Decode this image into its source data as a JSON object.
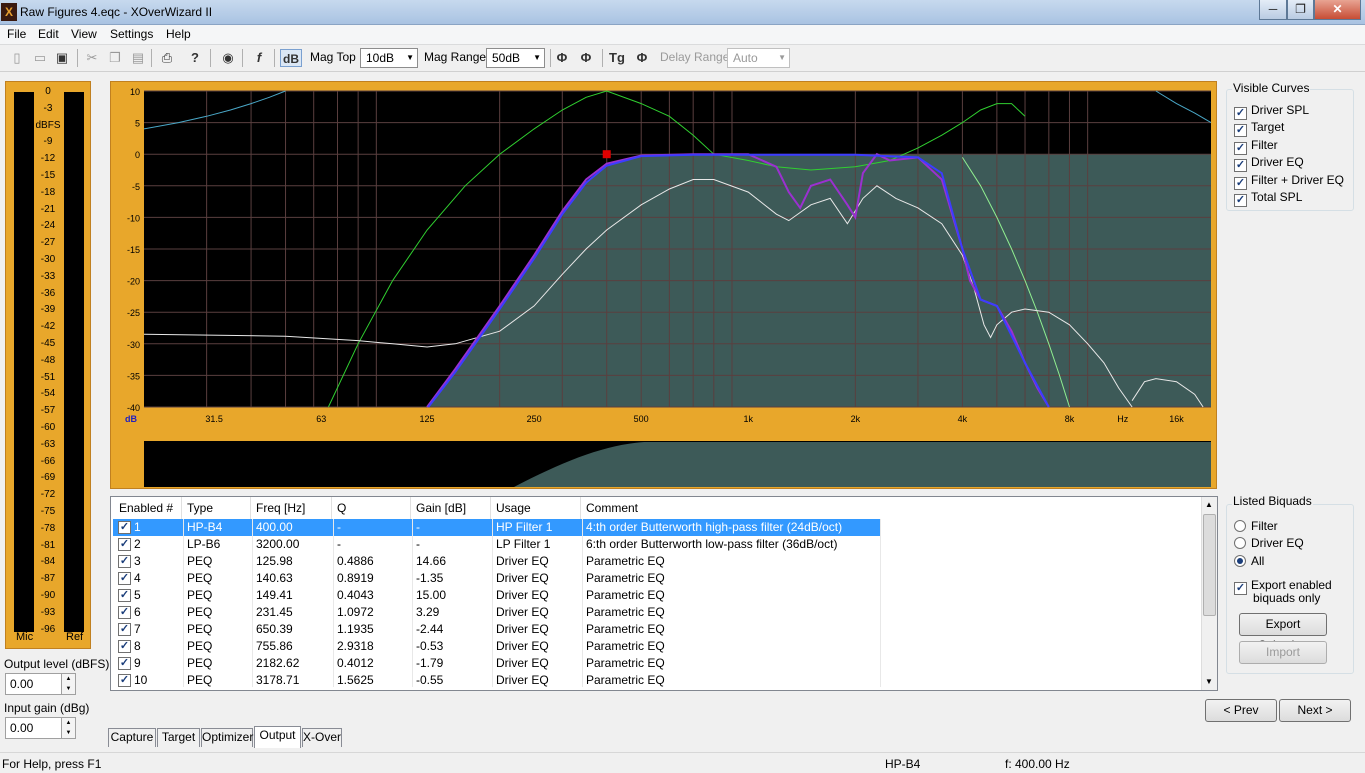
{
  "window": {
    "title": "Raw Figures 4.eqc - XOverWizard II",
    "app_icon": "X",
    "minimize": "─",
    "maximize": "❐",
    "close": "✕"
  },
  "menu": [
    "File",
    "Edit",
    "View",
    "Settings",
    "Help"
  ],
  "toolbar": {
    "db_button": "dB",
    "mag_top_label": "Mag Top",
    "mag_top_value": "10dB",
    "mag_range_label": "Mag Range",
    "mag_range_value": "50dB",
    "delay_range_label": "Delay Range",
    "delay_range_value": "Auto",
    "icons": [
      "new-icon",
      "open-icon",
      "save-icon",
      "cut-icon",
      "copy-icon",
      "paste-icon",
      "print-icon",
      "help-icon",
      "speaker-icon",
      "lock-icon",
      "phase-icon",
      "wrapped-phase-icon",
      "group-delay-icon",
      "delay-phase-icon"
    ]
  },
  "meter": {
    "unit": "dBFS",
    "ticks": [
      "0",
      "-3",
      "dBFS",
      "-9",
      "-12",
      "-15",
      "-18",
      "-21",
      "-24",
      "-27",
      "-30",
      "-33",
      "-36",
      "-39",
      "-42",
      "-45",
      "-48",
      "-51",
      "-54",
      "-57",
      "-60",
      "-63",
      "-66",
      "-69",
      "-72",
      "-75",
      "-78",
      "-81",
      "-84",
      "-87",
      "-90",
      "-93",
      "-96"
    ],
    "left_label": "Mic",
    "right_label": "Ref"
  },
  "output_level": {
    "label": "Output level (dBFS)",
    "value": "0.00"
  },
  "input_gain": {
    "label": "Input gain (dBg)",
    "value": "0.00"
  },
  "chart_data": {
    "type": "line",
    "yunit": "dB",
    "xunit": "Hz",
    "x_scale": "log",
    "xlim": [
      20,
      20000
    ],
    "ylim": [
      -40,
      10
    ],
    "x_ticks": [
      "31.5",
      "63",
      "125",
      "250",
      "500",
      "1k",
      "2k",
      "4k",
      "8k",
      "16k"
    ],
    "x_tick_values": [
      31.5,
      63,
      125,
      250,
      500,
      1000,
      2000,
      4000,
      8000,
      16000
    ],
    "y_ticks": [
      "10",
      "5",
      "0",
      "-5",
      "-10",
      "-15",
      "-20",
      "-25",
      "-30",
      "-35",
      "-40"
    ],
    "y_tick_values": [
      10,
      5,
      0,
      -5,
      -10,
      -15,
      -20,
      -25,
      -30,
      -35,
      -40
    ],
    "grid": true,
    "marker": {
      "x": 400,
      "y": 0
    },
    "colors": {
      "background": "#000000",
      "fill": "#3d5a58",
      "green": "#30d030",
      "light_green": "#90ee90",
      "blue": "#3c3cff",
      "purple": "#9b30d0",
      "white": "#e8e8e8",
      "cyan": "#4aa8c8",
      "marker": "#e00000"
    },
    "series": [
      {
        "color": "#30d030",
        "points": [
          [
            66,
            -40
          ],
          [
            80,
            -30
          ],
          [
            100,
            -20
          ],
          [
            125,
            -12
          ],
          [
            160,
            -5
          ],
          [
            200,
            0
          ],
          [
            250,
            4
          ],
          [
            300,
            7
          ],
          [
            350,
            9
          ],
          [
            400,
            10
          ],
          [
            500,
            8
          ],
          [
            600,
            6
          ],
          [
            700,
            3
          ],
          [
            800,
            0
          ],
          [
            1000,
            -1
          ],
          [
            1200,
            -2
          ],
          [
            1500,
            -2.5
          ],
          [
            2000,
            -2
          ],
          [
            2500,
            -1
          ],
          [
            3000,
            1
          ],
          [
            3500,
            3
          ],
          [
            4000,
            5
          ],
          [
            4500,
            7
          ],
          [
            5000,
            8
          ],
          [
            5500,
            8
          ],
          [
            6000,
            6
          ]
        ]
      },
      {
        "color": "#90ee90",
        "points": [
          [
            4000,
            -0.5
          ],
          [
            4500,
            -5
          ],
          [
            5000,
            -10
          ],
          [
            5500,
            -15
          ],
          [
            6000,
            -20
          ],
          [
            6500,
            -25
          ],
          [
            7000,
            -30
          ],
          [
            7500,
            -35
          ],
          [
            8000,
            -40
          ]
        ]
      },
      {
        "color": "#e8e8e8",
        "points": [
          [
            20,
            -28.5
          ],
          [
            50,
            -28.8
          ],
          [
            80,
            -29.5
          ],
          [
            100,
            -30
          ],
          [
            125,
            -30.5
          ],
          [
            150,
            -30
          ],
          [
            200,
            -28
          ],
          [
            250,
            -24
          ],
          [
            300,
            -19
          ],
          [
            350,
            -15
          ],
          [
            400,
            -12
          ],
          [
            500,
            -8
          ],
          [
            600,
            -5.5
          ],
          [
            700,
            -4
          ],
          [
            800,
            -4
          ],
          [
            1000,
            -6
          ],
          [
            1200,
            -9.5
          ],
          [
            1300,
            -10.5
          ],
          [
            1500,
            -8
          ],
          [
            1700,
            -7
          ],
          [
            1900,
            -11
          ],
          [
            2100,
            -7
          ],
          [
            2300,
            -5
          ],
          [
            2600,
            -7
          ],
          [
            3000,
            -8.5
          ],
          [
            3500,
            -11
          ],
          [
            4000,
            -16
          ],
          [
            4300,
            -21
          ],
          [
            4600,
            -27
          ],
          [
            4800,
            -29
          ],
          [
            5000,
            -27
          ],
          [
            5500,
            -25
          ],
          [
            6000,
            -24.5
          ],
          [
            7000,
            -25
          ],
          [
            8000,
            -27
          ],
          [
            9000,
            -30
          ],
          [
            10000,
            -33
          ],
          [
            11000,
            -37
          ],
          [
            12000,
            -40
          ]
        ]
      },
      {
        "color": "#e8e8e8",
        "points": [
          [
            12000,
            -39
          ],
          [
            13000,
            -36
          ],
          [
            14000,
            -35.5
          ],
          [
            16000,
            -36
          ],
          [
            18000,
            -38
          ],
          [
            19000,
            -40
          ]
        ]
      },
      {
        "color": "#4aa8c8",
        "points": [
          [
            20,
            4
          ],
          [
            25,
            5
          ],
          [
            30,
            6
          ],
          [
            35,
            7
          ],
          [
            40,
            8
          ],
          [
            45,
            9
          ],
          [
            50,
            10
          ]
        ]
      },
      {
        "color": "#4aa8c8",
        "points": [
          [
            14000,
            10
          ],
          [
            16000,
            8
          ],
          [
            18000,
            6.5
          ],
          [
            20000,
            5
          ]
        ]
      },
      {
        "color": "#9b30d0",
        "points": [
          [
            125,
            -40
          ],
          [
            150,
            -34
          ],
          [
            200,
            -24
          ],
          [
            250,
            -16
          ],
          [
            300,
            -9
          ],
          [
            350,
            -4
          ],
          [
            400,
            -1.5
          ],
          [
            500,
            -0.2
          ],
          [
            700,
            0
          ],
          [
            1000,
            0
          ],
          [
            1200,
            -2
          ],
          [
            1300,
            -6
          ],
          [
            1400,
            -8.5
          ],
          [
            1500,
            -5
          ],
          [
            1700,
            -4
          ],
          [
            1900,
            -8
          ],
          [
            2000,
            -10
          ],
          [
            2100,
            -3
          ],
          [
            2300,
            0
          ],
          [
            2500,
            -1
          ],
          [
            3000,
            -0.5
          ],
          [
            3500,
            -4
          ],
          [
            4000,
            -15
          ],
          [
            4200,
            -20
          ],
          [
            4500,
            -23
          ],
          [
            5000,
            -24
          ],
          [
            5500,
            -28
          ],
          [
            6000,
            -33
          ],
          [
            6500,
            -37
          ],
          [
            7000,
            -40
          ]
        ]
      },
      {
        "color": "#3c3cff",
        "points": [
          [
            126,
            -40
          ],
          [
            150,
            -34.5
          ],
          [
            200,
            -24.5
          ],
          [
            250,
            -16.5
          ],
          [
            300,
            -9.5
          ],
          [
            350,
            -4.5
          ],
          [
            400,
            -1.8
          ],
          [
            500,
            -0.3
          ],
          [
            700,
            -0.1
          ],
          [
            1000,
            -0.1
          ],
          [
            2000,
            -0.1
          ],
          [
            3000,
            -0.5
          ],
          [
            3500,
            -3
          ],
          [
            4000,
            -15
          ],
          [
            4500,
            -23
          ],
          [
            5000,
            -24
          ],
          [
            6000,
            -33
          ],
          [
            7000,
            -40
          ]
        ]
      }
    ]
  },
  "visible_curves": {
    "title": "Visible Curves",
    "items": [
      {
        "label": "Driver SPL",
        "checked": "✓"
      },
      {
        "label": "Target",
        "checked": "✓"
      },
      {
        "label": "Filter",
        "checked": "✓"
      },
      {
        "label": "Driver EQ",
        "checked": "✓"
      },
      {
        "label": "Filter + Driver EQ",
        "checked": "✓"
      },
      {
        "label": "Total SPL",
        "checked": "✓"
      }
    ]
  },
  "table": {
    "headers": [
      "Enabled #",
      "Type",
      "Freq [Hz]",
      "Q",
      "Gain [dB]",
      "Usage",
      "Comment"
    ],
    "rows": [
      {
        "num": "1",
        "type": "HP-B4",
        "freq": "400.00",
        "q": "-",
        "gain": "-",
        "usage": "HP Filter 1",
        "comment": "4:th order Butterworth high-pass filter (24dB/oct)"
      },
      {
        "num": "2",
        "type": "LP-B6",
        "freq": "3200.00",
        "q": "-",
        "gain": "-",
        "usage": "LP Filter 1",
        "comment": "6:th order Butterworth low-pass filter (36dB/oct)"
      },
      {
        "num": "3",
        "type": "PEQ",
        "freq": "125.98",
        "q": "0.4886",
        "gain": "14.66",
        "usage": "Driver EQ",
        "comment": "Parametric EQ"
      },
      {
        "num": "4",
        "type": "PEQ",
        "freq": "140.63",
        "q": "0.8919",
        "gain": "-1.35",
        "usage": "Driver EQ",
        "comment": "Parametric EQ"
      },
      {
        "num": "5",
        "type": "PEQ",
        "freq": "149.41",
        "q": "0.4043",
        "gain": "15.00",
        "usage": "Driver EQ",
        "comment": "Parametric EQ"
      },
      {
        "num": "6",
        "type": "PEQ",
        "freq": "231.45",
        "q": "1.0972",
        "gain": "3.29",
        "usage": "Driver EQ",
        "comment": "Parametric EQ"
      },
      {
        "num": "7",
        "type": "PEQ",
        "freq": "650.39",
        "q": "1.1935",
        "gain": "-2.44",
        "usage": "Driver EQ",
        "comment": "Parametric EQ"
      },
      {
        "num": "8",
        "type": "PEQ",
        "freq": "755.86",
        "q": "2.9318",
        "gain": "-0.53",
        "usage": "Driver EQ",
        "comment": "Parametric EQ"
      },
      {
        "num": "9",
        "type": "PEQ",
        "freq": "2182.62",
        "q": "0.4012",
        "gain": "-1.79",
        "usage": "Driver EQ",
        "comment": "Parametric EQ"
      },
      {
        "num": "10",
        "type": "PEQ",
        "freq": "3178.71",
        "q": "1.5625",
        "gain": "-0.55",
        "usage": "Driver EQ",
        "comment": "Parametric EQ"
      }
    ]
  },
  "listed_biquads": {
    "title": "Listed Biquads",
    "options": [
      "Filter",
      "Driver EQ",
      "All"
    ],
    "selected": "All",
    "export_enabled_label": "Export enabled biquads only",
    "export_enabled_line1": "Export enabled",
    "export_enabled_line2": "biquads only",
    "export_selection": "Export Selection",
    "import": "Import"
  },
  "nav": {
    "prev": "< Prev",
    "next": "Next >"
  },
  "tabs": [
    {
      "label": "Capture",
      "active": false
    },
    {
      "label": "Target",
      "active": false
    },
    {
      "label": "Optimizer",
      "active": false
    },
    {
      "label": "Output",
      "active": true
    },
    {
      "label": "X-Over",
      "active": false
    }
  ],
  "status": {
    "help": "For Help, press F1",
    "filter": "HP-B4",
    "freq": "f: 400.00 Hz"
  }
}
